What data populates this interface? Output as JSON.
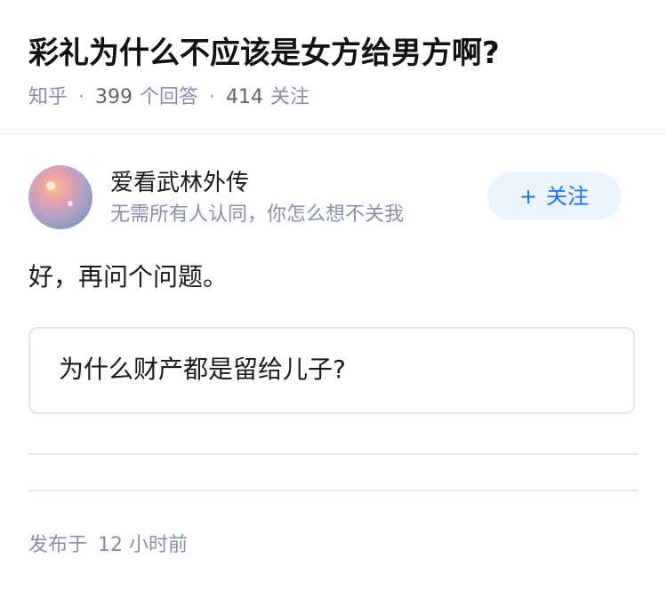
{
  "question": {
    "title": "彩礼为什么不应该是女方给男方啊?",
    "source": "知乎",
    "separator": "·",
    "answer_count": "399",
    "answer_label": "个回答",
    "follower_count": "414",
    "follower_label": "关注"
  },
  "author": {
    "name": "爱看武林外传",
    "bio": "无需所有人认同，你怎么想不关我",
    "follow_plus": "+",
    "follow_label": "关注"
  },
  "answer": {
    "text": "好，再问个问题。",
    "quote": "为什么财产都是留给儿子?"
  },
  "footer": {
    "publish_label": "发布于",
    "publish_time": "12 小时前"
  }
}
